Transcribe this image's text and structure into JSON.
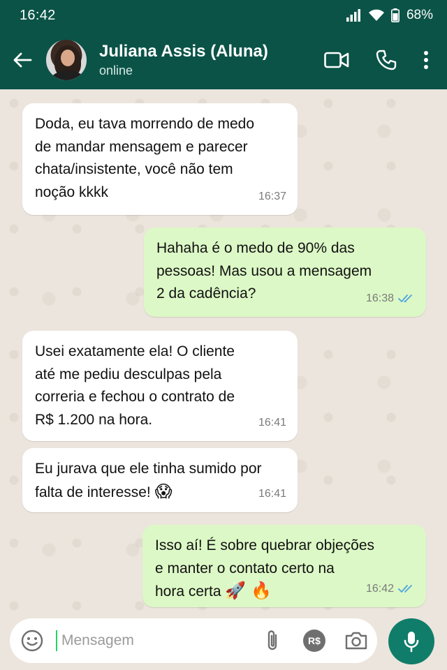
{
  "status_bar": {
    "time": "16:42",
    "battery": "68%",
    "icons": [
      "signal-icon",
      "wifi-icon",
      "battery-icon"
    ]
  },
  "header": {
    "contact_name": "Juliana Assis (Aluna)",
    "status": "online",
    "icons": [
      "back-arrow-icon",
      "video-call-icon",
      "phone-icon",
      "more-vert-icon"
    ]
  },
  "messages": [
    {
      "direction": "in",
      "text": "Doda, eu tava morrendo de medo\nde mandar mensagem e parecer\nchata/insistente, você não tem\nnoção kkkk",
      "time": "16:37"
    },
    {
      "direction": "out",
      "text": "Hahaha é o medo de 90% das\npessoas! Mas usou a mensagem\n2 da cadência?",
      "time": "16:38",
      "read": true
    },
    {
      "direction": "in",
      "text": "Usei exatamente ela! O cliente\naté me pediu desculpas pela\ncorreria e fechou o contrato de\nR$ 1.200 na hora.",
      "time": "16:41"
    },
    {
      "direction": "in",
      "text": "Eu jurava que ele tinha sumido por\nfalta de interesse! ",
      "emoji": "😱",
      "time": "16:41"
    },
    {
      "direction": "out",
      "text": "Isso aí! É sobre quebrar objeções\ne manter o contato certo na\nhora certa ",
      "emoji": "🚀 🔥",
      "time": "16:42",
      "read": true
    }
  ],
  "input_bar": {
    "placeholder": "Mensagem",
    "currency_label": "R$",
    "icons": [
      "emoji-icon",
      "attach-icon",
      "currency-icon",
      "camera-icon",
      "mic-icon"
    ]
  },
  "colors": {
    "header": "#0b5347",
    "outgoing_bubble": "#dcf8c6",
    "incoming_bubble": "#ffffff",
    "read_ticks": "#4fa3e0",
    "mic_button": "#0f7d6a"
  }
}
